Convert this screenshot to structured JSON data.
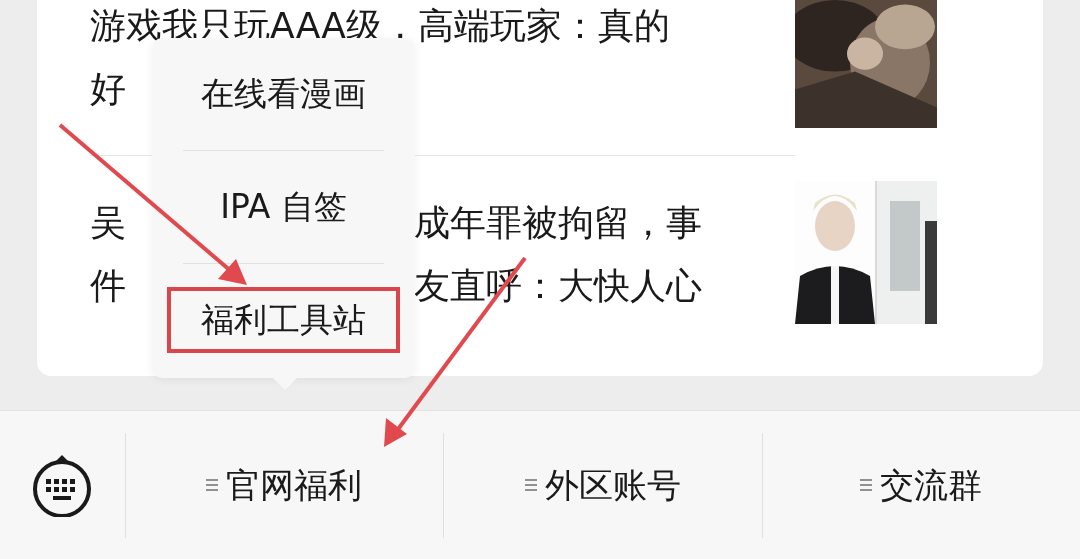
{
  "articles": [
    {
      "lines": [
        {
          "left": "游戏我只玩AAA级，高端玩家：真的"
        },
        {
          "left": "好"
        }
      ]
    },
    {
      "lines": [
        {
          "left": "吴",
          "right": "成年罪被拘留，事"
        },
        {
          "left": "件",
          "right": "友直呼：大快人心"
        }
      ]
    }
  ],
  "popup_menu": {
    "items": [
      {
        "label": "在线看漫画",
        "highlighted": false
      },
      {
        "label": "IPA 自签",
        "highlighted": false
      },
      {
        "label": "福利工具站",
        "highlighted": true
      }
    ]
  },
  "bottom_menu": {
    "tabs": [
      {
        "label": "官网福利"
      },
      {
        "label": "外区账号"
      },
      {
        "label": "交流群"
      }
    ]
  }
}
